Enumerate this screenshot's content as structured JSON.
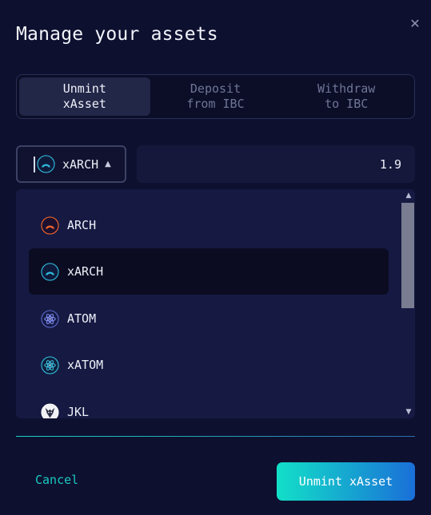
{
  "modal": {
    "title": "Manage your assets",
    "close_icon": "close-icon"
  },
  "tabs": [
    {
      "label": "Unmint\nxAsset",
      "active": true
    },
    {
      "label": "Deposit\nfrom IBC",
      "active": false
    },
    {
      "label": "Withdraw\nto IBC",
      "active": false
    }
  ],
  "asset_select": {
    "selected": "xARCH",
    "icon": "xarch-coin-icon",
    "chevron_icon": "chevron-up-icon"
  },
  "amount": {
    "value": "1.9"
  },
  "dropdown": {
    "options": [
      {
        "label": "ARCH",
        "icon": "arch-coin-icon",
        "selected": false
      },
      {
        "label": "xARCH",
        "icon": "xarch-coin-icon",
        "selected": true
      },
      {
        "label": "ATOM",
        "icon": "atom-coin-icon",
        "selected": false
      },
      {
        "label": "xATOM",
        "icon": "xatom-coin-icon",
        "selected": false
      },
      {
        "label": "JKL",
        "icon": "jkl-coin-icon",
        "selected": false
      }
    ]
  },
  "footer": {
    "cancel_label": "Cancel",
    "submit_label": "Unmint xAsset"
  },
  "colors": {
    "background": "#0e1030",
    "accent": "#19c9c0",
    "button_gradient_start": "#12e0c8",
    "button_gradient_end": "#1a6fd8"
  }
}
